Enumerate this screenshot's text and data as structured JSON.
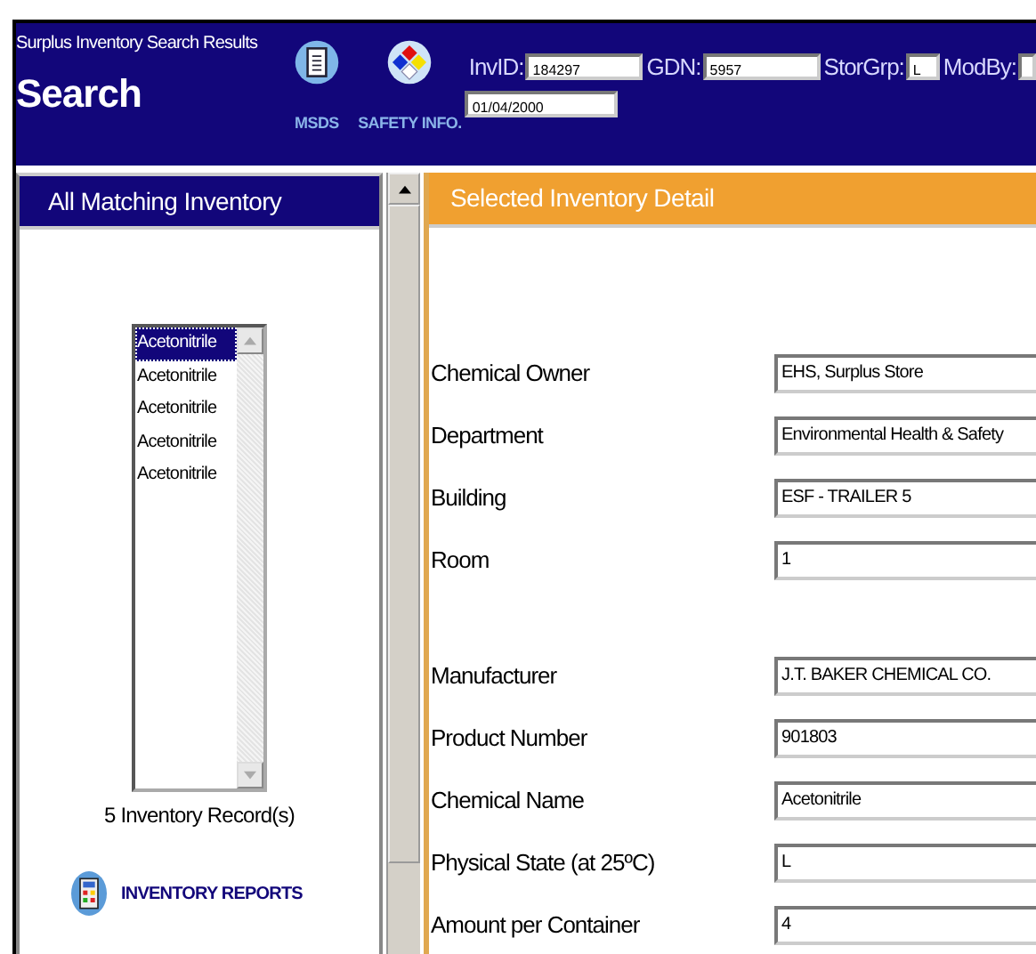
{
  "header": {
    "title": "Surplus Inventory Search Results",
    "heading": "Search",
    "tools": [
      {
        "kind": "msds",
        "label": "MSDS"
      },
      {
        "kind": "safety",
        "label": "SAFETY INFO."
      }
    ],
    "fields": [
      {
        "label": "InvID:",
        "value": "184297",
        "kind": "wide"
      },
      {
        "label": "GDN:",
        "value": "5957",
        "kind": "wide"
      },
      {
        "label": "StorGrp:",
        "value": "L",
        "kind": "narrow"
      },
      {
        "label": "ModBy:",
        "kind": "cut"
      }
    ],
    "date_field": {
      "value": "01/04/2000"
    }
  },
  "sidebar": {
    "title": "All Matching Inventory",
    "items": [
      {
        "label": "Acetonitrile",
        "selected": true
      },
      {
        "label": "Acetonitrile",
        "selected": false
      },
      {
        "label": "Acetonitrile",
        "selected": false
      },
      {
        "label": "Acetonitrile",
        "selected": false
      },
      {
        "label": "Acetonitrile",
        "selected": false
      }
    ],
    "count": "5 Inventory Record(s)",
    "reports_link": "INVENTORY REPORTS"
  },
  "detail": {
    "title": "Selected Inventory Detail",
    "groups": [
      [
        {
          "label": "Chemical Owner",
          "value": "EHS, Surplus Store"
        },
        {
          "label": "Department",
          "value": "Environmental Health & Safety"
        },
        {
          "label": "Building",
          "value": "ESF - TRAILER 5"
        },
        {
          "label": "Room",
          "value": "1"
        }
      ],
      [
        {
          "label": "Manufacturer",
          "value": "J.T. BAKER CHEMICAL CO."
        },
        {
          "label": "Product Number",
          "value": "901803"
        },
        {
          "label": "Chemical Name",
          "value": "Acetonitrile"
        },
        {
          "label": "Physical State (at 25ºC)",
          "value": "L"
        },
        {
          "label": "Amount per Container",
          "value": "4"
        }
      ]
    ]
  }
}
